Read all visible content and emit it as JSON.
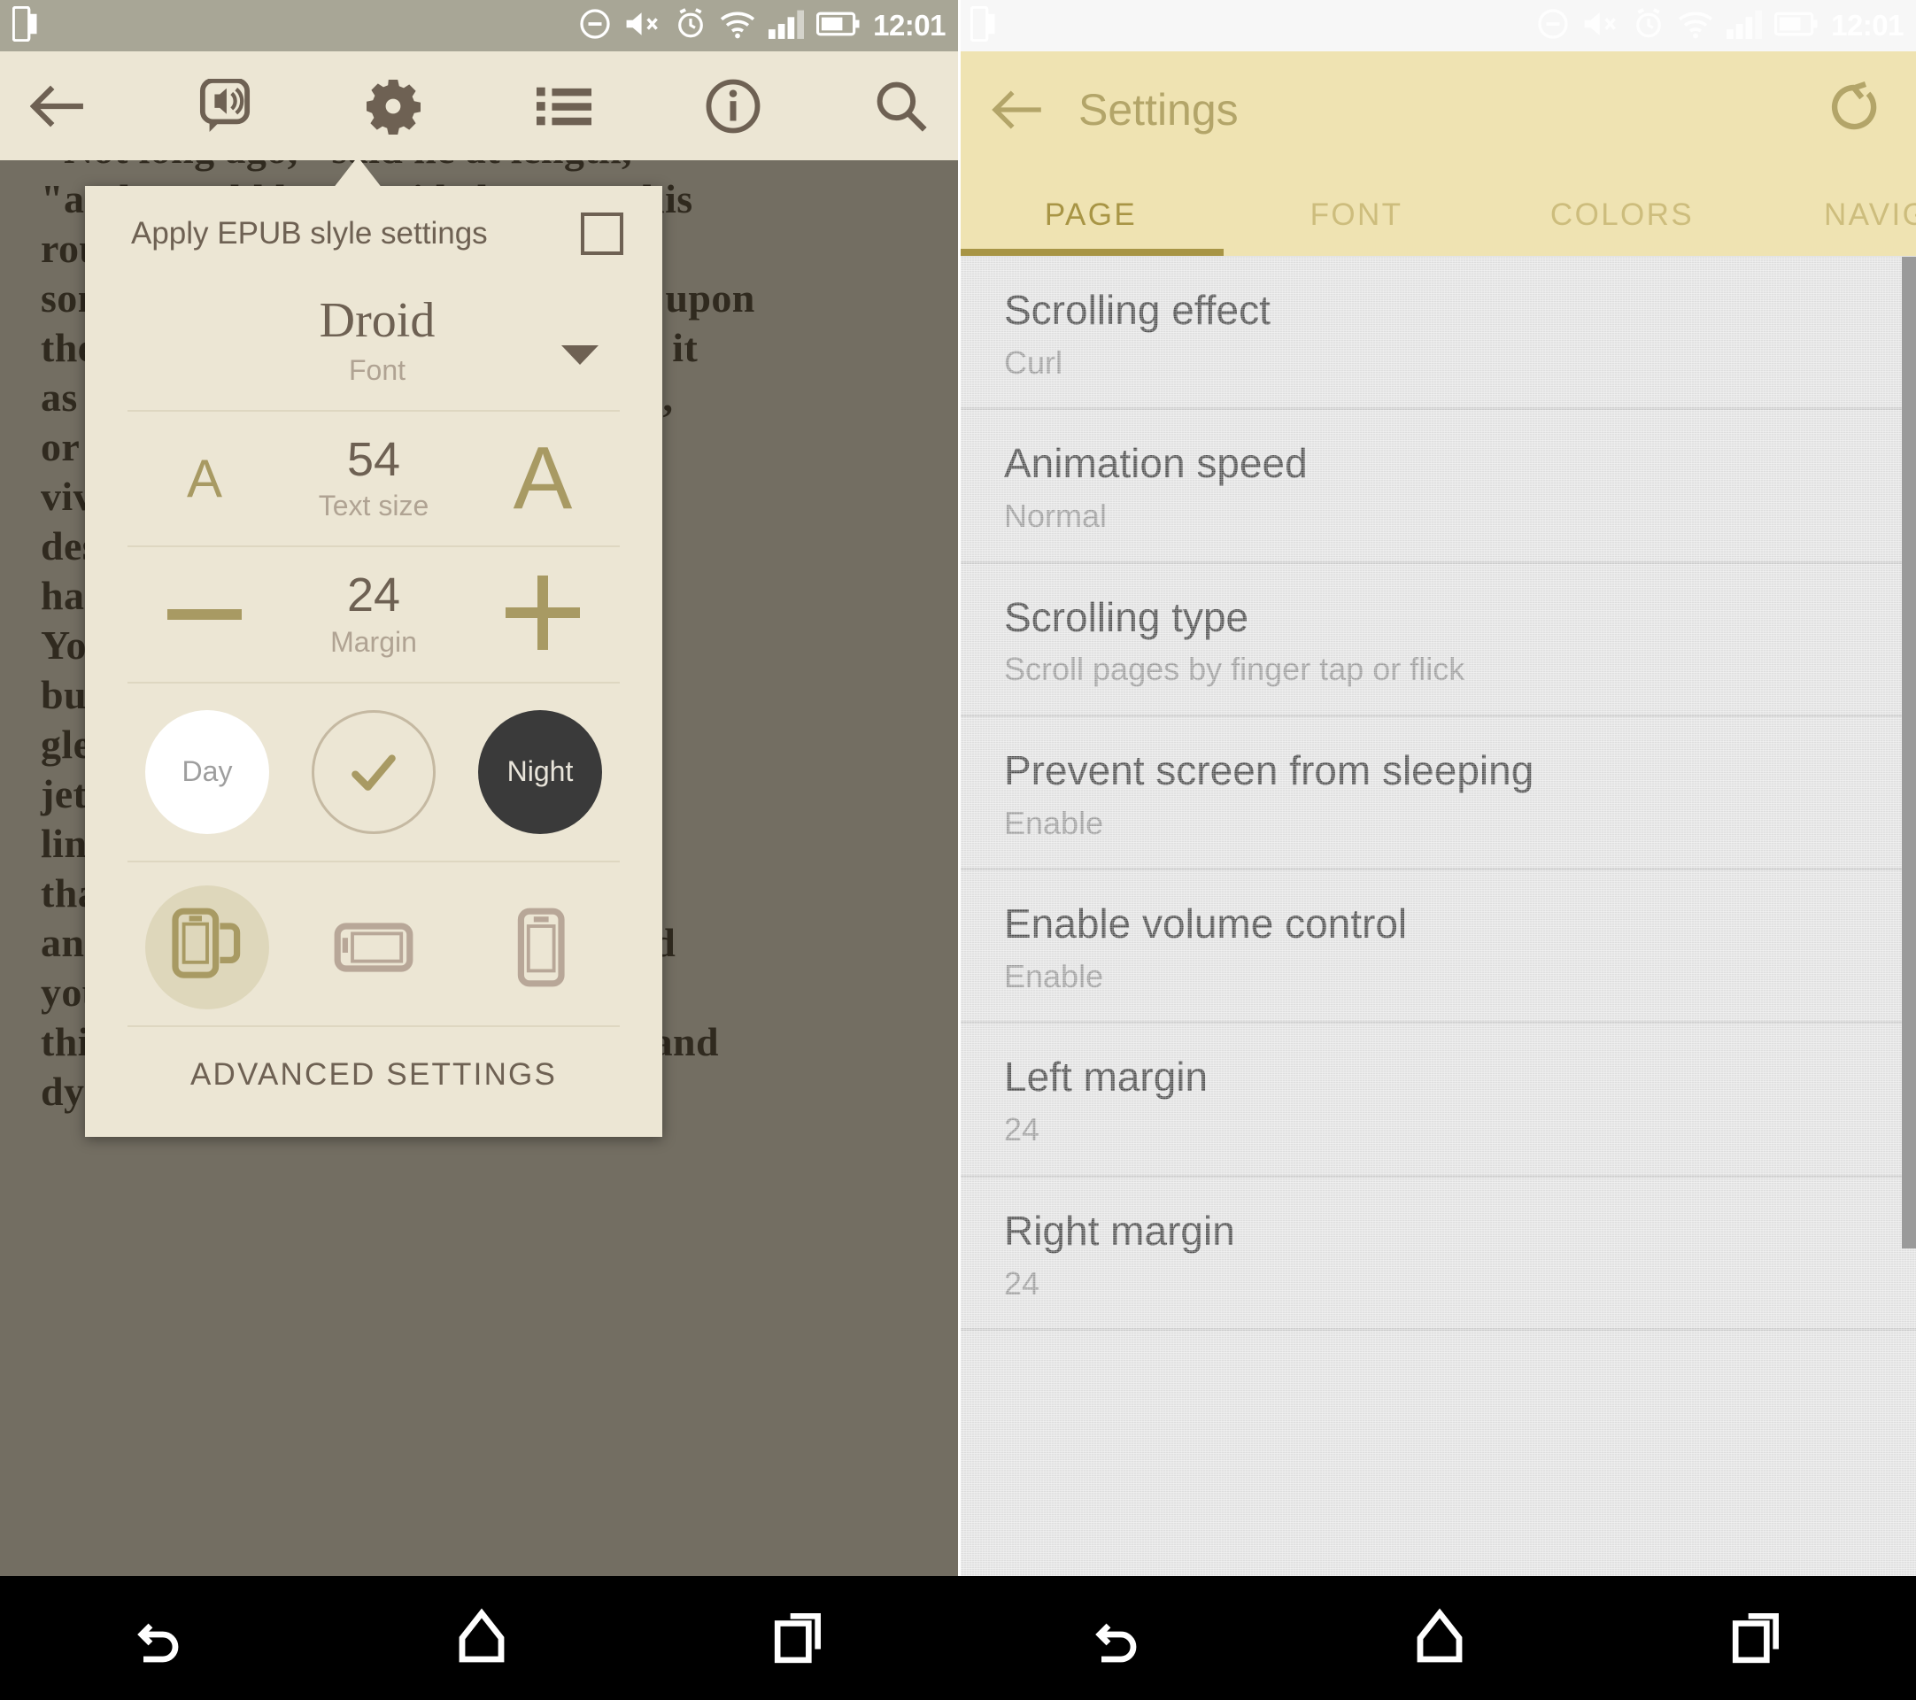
{
  "status_bar": {
    "time": "12:01",
    "icons": [
      "rotation-lock-icon",
      "volume-mute-icon",
      "alarm-icon",
      "wifi-icon",
      "signal-icon",
      "battery-icon"
    ]
  },
  "reader": {
    "toolbar_icons": [
      "back-arrow-icon",
      "text-to-speech-icon",
      "settings-gear-icon",
      "table-of-contents-icon",
      "info-icon",
      "search-icon"
    ],
    "page_text": "\"Not long ago,\" said he at length,\n\"and I could have guided you on this\nroute as easily as my shadow;\nsomething had then begun to press upon\nthe sill of my eyes; and I looked for it\nas upon a thing that would be mine,\nor the vision of my own mind, as\nvividly as I have ever seen the\ndeserted room and the candle that\nhad not yet been lighted there.\nYou will find it difficult, perhaps,\nbut when the sun is low and the\ngleam is on the water, and every\njet of spray is burning at the\nline of the shore, you will know\nthat it is the same thing that I saw,\nand that it is not a dream at all, and\nyou will remember then that I told\nthis to you upon a night long past, and\ndying.",
    "page_text_ghost": "\"Not long ago,\" said he at length,"
  },
  "popup": {
    "checkbox_label": "Apply EPUB slyle settings",
    "checkbox_checked": false,
    "font": {
      "value": "Droid",
      "label": "Font"
    },
    "text_size": {
      "value": "54",
      "label": "Text size",
      "decrease_icon": "small-a-icon",
      "increase_icon": "large-a-icon"
    },
    "margin": {
      "value": "24",
      "label": "Margin",
      "decrease_icon": "minus-icon",
      "increase_icon": "plus-icon"
    },
    "themes": [
      {
        "name": "day-theme-button",
        "label": "Day",
        "selected": false
      },
      {
        "name": "sepia-theme-button",
        "label": "",
        "selected": true
      },
      {
        "name": "night-theme-button",
        "label": "Night",
        "selected": false
      }
    ],
    "orientations": [
      {
        "name": "orientation-auto-icon",
        "selected": true
      },
      {
        "name": "orientation-landscape-icon",
        "selected": false
      },
      {
        "name": "orientation-portrait-icon",
        "selected": false
      }
    ],
    "advanced_label": "ADVANCED SETTINGS"
  },
  "settings": {
    "title": "Settings",
    "back_icon": "back-arrow-icon",
    "reset_icon": "reset-icon",
    "tabs": [
      {
        "label": "PAGE",
        "active": true
      },
      {
        "label": "FONT",
        "active": false
      },
      {
        "label": "COLORS",
        "active": false
      },
      {
        "label": "NAVIGA",
        "active": false
      }
    ],
    "items": [
      {
        "title": "Scrolling effect",
        "value": "Curl"
      },
      {
        "title": "Animation speed",
        "value": "Normal"
      },
      {
        "title": "Scrolling type",
        "value": "Scroll pages by finger tap or flick"
      },
      {
        "title": "Prevent screen from sleeping",
        "value": "Enable"
      },
      {
        "title": "Enable volume control",
        "value": "Enable"
      },
      {
        "title": "Left margin",
        "value": "24"
      },
      {
        "title": "Right margin",
        "value": "24"
      }
    ]
  },
  "navbar": {
    "buttons": [
      "back-nav-icon",
      "home-nav-icon",
      "recents-nav-icon"
    ]
  },
  "colors": {
    "reader_bg": "#ece6d4",
    "accent_gold": "#a89a63",
    "settings_appbar": "#efe3b2",
    "settings_accent": "#b3a569",
    "list_bg": "#e7e7e7"
  }
}
